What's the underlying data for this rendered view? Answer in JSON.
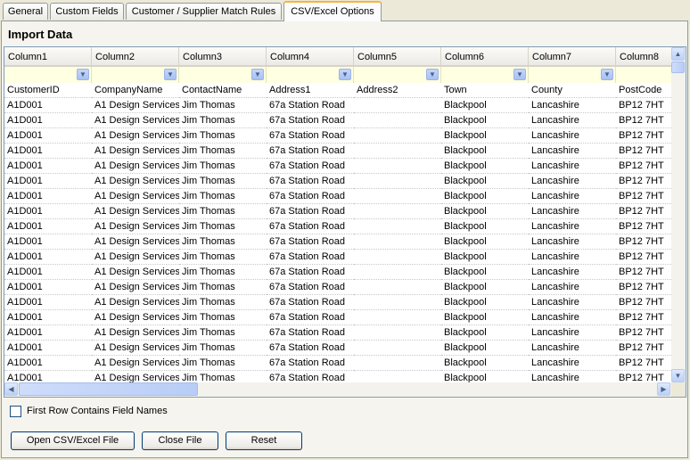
{
  "tabs": [
    {
      "label": "General"
    },
    {
      "label": "Custom Fields"
    },
    {
      "label": "Customer / Supplier Match Rules"
    },
    {
      "label": "CSV/Excel Options"
    }
  ],
  "group_title": "Import Data",
  "grid": {
    "columns": [
      "Column1",
      "Column2",
      "Column3",
      "Column4",
      "Column5",
      "Column6",
      "Column7",
      "Column8"
    ],
    "rows": [
      [
        "CustomerID",
        "CompanyName",
        "ContactName",
        "Address1",
        "Address2",
        "Town",
        "County",
        "PostCode"
      ],
      [
        "A1D001",
        "A1  Design Services",
        "Jim Thomas",
        "67a Station Road",
        "",
        "Blackpool",
        "Lancashire",
        "BP12 7HT"
      ],
      [
        "A1D001",
        "A1  Design Services",
        "Jim Thomas",
        "67a Station Road",
        "",
        "Blackpool",
        "Lancashire",
        "BP12 7HT"
      ],
      [
        "A1D001",
        "A1  Design Services",
        "Jim Thomas",
        "67a Station Road",
        "",
        "Blackpool",
        "Lancashire",
        "BP12 7HT"
      ],
      [
        "A1D001",
        "A1  Design Services",
        "Jim Thomas",
        "67a Station Road",
        "",
        "Blackpool",
        "Lancashire",
        "BP12 7HT"
      ],
      [
        "A1D001",
        "A1  Design Services",
        "Jim Thomas",
        "67a Station Road",
        "",
        "Blackpool",
        "Lancashire",
        "BP12 7HT"
      ],
      [
        "A1D001",
        "A1  Design Services",
        "Jim Thomas",
        "67a Station Road",
        "",
        "Blackpool",
        "Lancashire",
        "BP12 7HT"
      ],
      [
        "A1D001",
        "A1  Design Services",
        "Jim Thomas",
        "67a Station Road",
        "",
        "Blackpool",
        "Lancashire",
        "BP12 7HT"
      ],
      [
        "A1D001",
        "A1  Design Services",
        "Jim Thomas",
        "67a Station Road",
        "",
        "Blackpool",
        "Lancashire",
        "BP12 7HT"
      ],
      [
        "A1D001",
        "A1  Design Services",
        "Jim Thomas",
        "67a Station Road",
        "",
        "Blackpool",
        "Lancashire",
        "BP12 7HT"
      ],
      [
        "A1D001",
        "A1  Design Services",
        "Jim Thomas",
        "67a Station Road",
        "",
        "Blackpool",
        "Lancashire",
        "BP12 7HT"
      ],
      [
        "A1D001",
        "A1  Design Services",
        "Jim Thomas",
        "67a Station Road",
        "",
        "Blackpool",
        "Lancashire",
        "BP12 7HT"
      ],
      [
        "A1D001",
        "A1  Design Services",
        "Jim Thomas",
        "67a Station Road",
        "",
        "Blackpool",
        "Lancashire",
        "BP12 7HT"
      ],
      [
        "A1D001",
        "A1  Design Services",
        "Jim Thomas",
        "67a Station Road",
        "",
        "Blackpool",
        "Lancashire",
        "BP12 7HT"
      ],
      [
        "A1D001",
        "A1  Design Services",
        "Jim Thomas",
        "67a Station Road",
        "",
        "Blackpool",
        "Lancashire",
        "BP12 7HT"
      ],
      [
        "A1D001",
        "A1  Design Services",
        "Jim Thomas",
        "67a Station Road",
        "",
        "Blackpool",
        "Lancashire",
        "BP12 7HT"
      ],
      [
        "A1D001",
        "A1  Design Services",
        "Jim Thomas",
        "67a Station Road",
        "",
        "Blackpool",
        "Lancashire",
        "BP12 7HT"
      ],
      [
        "A1D001",
        "A1  Design Services",
        "Jim Thomas",
        "67a Station Road",
        "",
        "Blackpool",
        "Lancashire",
        "BP12 7HT"
      ],
      [
        "A1D001",
        "A1  Design Services",
        "Jim Thomas",
        "67a Station Road",
        "",
        "Blackpool",
        "Lancashire",
        "BP12 7HT"
      ],
      [
        "A1D001",
        "A1  Design Services",
        "Jim Thomas",
        "67a Station Road",
        "",
        "Blackpool",
        "Lancashire",
        "BP12 7HT"
      ]
    ]
  },
  "options": {
    "first_row_label": "First Row Contains Field Names",
    "first_row_checked": false
  },
  "buttons": {
    "open": "Open CSV/Excel File",
    "close": "Close File",
    "reset": "Reset"
  },
  "icons": {
    "filter_dropdown": "chevron-down-icon",
    "scroll_up": "scroll-up-icon",
    "scroll_down": "scroll-down-icon",
    "scroll_left": "scroll-left-icon",
    "scroll_right": "scroll-right-icon"
  },
  "colors": {
    "active_tab_accent": "#f6b53a",
    "filter_row": "#ffffe1",
    "window_bg": "#ece9d8"
  }
}
